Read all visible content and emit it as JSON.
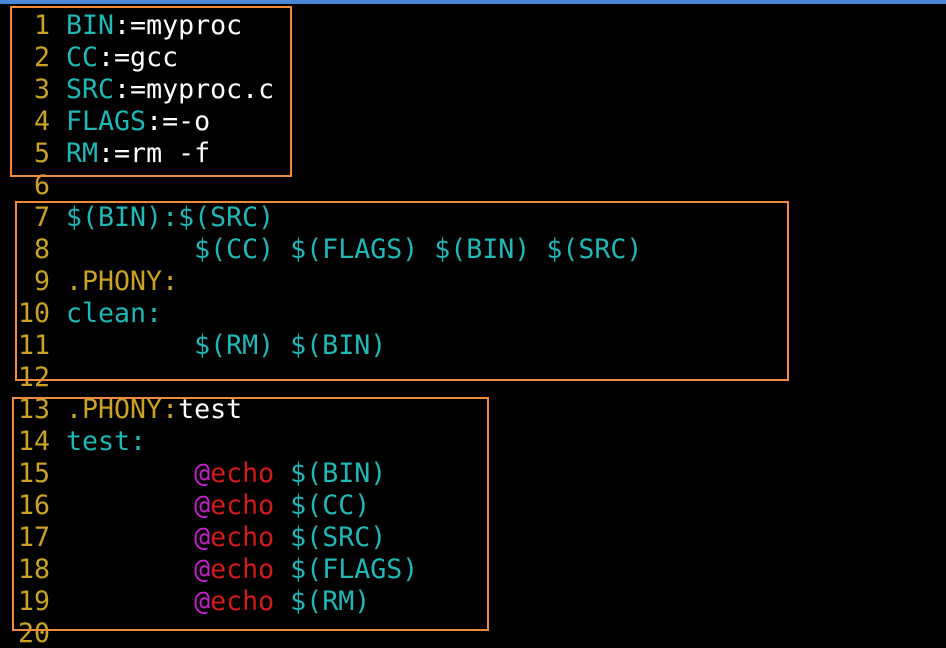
{
  "editor": {
    "lines": [
      {
        "num": "1",
        "tokens": [
          {
            "t": "BIN",
            "c": "var"
          },
          {
            "t": ":=myproc",
            "c": "txt"
          }
        ]
      },
      {
        "num": "2",
        "tokens": [
          {
            "t": "CC",
            "c": "var"
          },
          {
            "t": ":=gcc",
            "c": "txt"
          }
        ]
      },
      {
        "num": "3",
        "tokens": [
          {
            "t": "SRC",
            "c": "var"
          },
          {
            "t": ":=myproc.c",
            "c": "txt"
          }
        ]
      },
      {
        "num": "4",
        "tokens": [
          {
            "t": "FLAGS",
            "c": "var"
          },
          {
            "t": ":=-o",
            "c": "txt"
          }
        ]
      },
      {
        "num": "5",
        "tokens": [
          {
            "t": "RM",
            "c": "var"
          },
          {
            "t": ":=rm -f",
            "c": "txt"
          }
        ]
      },
      {
        "num": "6",
        "tokens": []
      },
      {
        "num": "7",
        "tokens": [
          {
            "t": "$(BIN):$(SRC)",
            "c": "var"
          }
        ]
      },
      {
        "num": "8",
        "tokens": [
          {
            "t": "        ",
            "c": "txt"
          },
          {
            "t": "$(CC) $(FLAGS) $(BIN) $(SRC)",
            "c": "var"
          }
        ]
      },
      {
        "num": "9",
        "tokens": [
          {
            "t": ".PHONY:",
            "c": "yel"
          }
        ]
      },
      {
        "num": "10",
        "tokens": [
          {
            "t": "clean:",
            "c": "var"
          }
        ]
      },
      {
        "num": "11",
        "tokens": [
          {
            "t": "        ",
            "c": "txt"
          },
          {
            "t": "$(RM) $(BIN)",
            "c": "var"
          }
        ]
      },
      {
        "num": "12",
        "tokens": []
      },
      {
        "num": "13",
        "tokens": [
          {
            "t": ".PHONY:",
            "c": "yel"
          },
          {
            "t": "test",
            "c": "txt"
          }
        ]
      },
      {
        "num": "14",
        "tokens": [
          {
            "t": "test:",
            "c": "var"
          }
        ]
      },
      {
        "num": "15",
        "tokens": [
          {
            "t": "        ",
            "c": "txt"
          },
          {
            "t": "@",
            "c": "at"
          },
          {
            "t": "echo",
            "c": "echo"
          },
          {
            "t": " $(BIN)",
            "c": "var"
          }
        ]
      },
      {
        "num": "16",
        "tokens": [
          {
            "t": "        ",
            "c": "txt"
          },
          {
            "t": "@",
            "c": "at"
          },
          {
            "t": "echo",
            "c": "echo"
          },
          {
            "t": " $(CC)",
            "c": "var"
          }
        ]
      },
      {
        "num": "17",
        "tokens": [
          {
            "t": "        ",
            "c": "txt"
          },
          {
            "t": "@",
            "c": "at"
          },
          {
            "t": "echo",
            "c": "echo"
          },
          {
            "t": " $(SRC)",
            "c": "var"
          }
        ]
      },
      {
        "num": "18",
        "tokens": [
          {
            "t": "        ",
            "c": "txt"
          },
          {
            "t": "@",
            "c": "at"
          },
          {
            "t": "echo",
            "c": "echo"
          },
          {
            "t": " $(FLAGS)",
            "c": "var"
          }
        ]
      },
      {
        "num": "19",
        "tokens": [
          {
            "t": "        ",
            "c": "txt"
          },
          {
            "t": "@",
            "c": "at"
          },
          {
            "t": "echo",
            "c": "echo"
          },
          {
            "t": " $(RM)",
            "c": "var"
          }
        ]
      },
      {
        "num": "20",
        "tokens": []
      }
    ]
  },
  "colors": {
    "background": "#000000",
    "line_number": "#c9a227",
    "variable": "#21b7b7",
    "text": "#ffffff",
    "keyword": "#c9a227",
    "at_sign": "#c51fc5",
    "echo": "#d11a1a",
    "highlight_box": "#f08a3c",
    "top_bar": "#4a88d6"
  }
}
